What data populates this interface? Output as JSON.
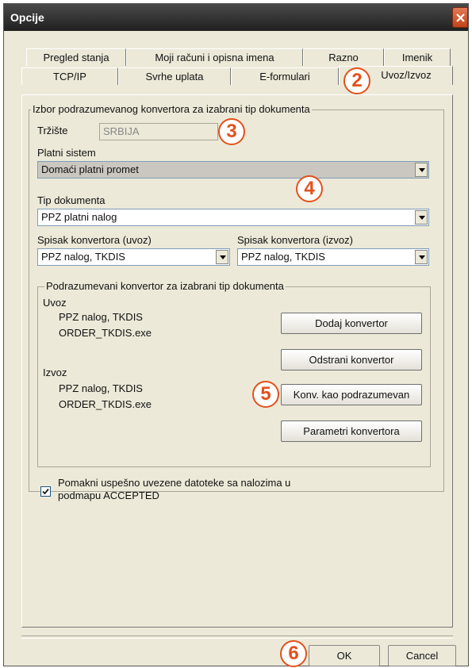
{
  "window": {
    "title": "Opcije"
  },
  "tabs_row1": [
    "Pregled stanja",
    "Moji računi i opisna imena",
    "Razno",
    "Imenik"
  ],
  "tabs_row2": [
    "TCP/IP",
    "Svrhe uplata",
    "E-formulari",
    "Uvoz/Izvoz"
  ],
  "group_main": {
    "legend": "Izbor podrazumevanog konvertora za izabrani tip dokumenta"
  },
  "trziste": {
    "label": "Tržište",
    "value": "SRBIJA"
  },
  "platni_sistem": {
    "label": "Platni sistem",
    "value": "Domaći platni promet"
  },
  "tip_dokumenta": {
    "label": "Tip dokumenta",
    "value": "PPZ platni nalog"
  },
  "spisak_uvoz": {
    "label": "Spisak konvertora (uvoz)",
    "value": "PPZ nalog, TKDIS"
  },
  "spisak_izvoz": {
    "label": "Spisak konvertora (izvoz)",
    "value": "PPZ nalog, TKDIS"
  },
  "group_default": {
    "legend": "Podrazumevani konvertor za izabrani tip dokumenta",
    "uvoz_title": "Uvoz",
    "uvoz_line1": "PPZ nalog, TKDIS",
    "uvoz_line2": "ORDER_TKDIS.exe",
    "izvoz_title": "Izvoz",
    "izvoz_line1": "PPZ nalog, TKDIS",
    "izvoz_line2": "ORDER_TKDIS.exe"
  },
  "buttons": {
    "dodaj": "Dodaj konvertor",
    "odstrani": "Odstrani konvertor",
    "konv_default": "Konv. kao podrazumevan",
    "parametri": "Parametri konvertora",
    "ok": "OK",
    "cancel": "Cancel"
  },
  "checkbox": {
    "checked": true,
    "line1": "Pomakni uspešno uvezene datoteke sa nalozima u",
    "line2": "podmapu ACCEPTED"
  },
  "badges": [
    "2",
    "3",
    "4",
    "5",
    "6"
  ],
  "colors": {
    "badge": "#e2511c",
    "titlebar": "#202020",
    "dialog_bg": "#ece9d8"
  }
}
